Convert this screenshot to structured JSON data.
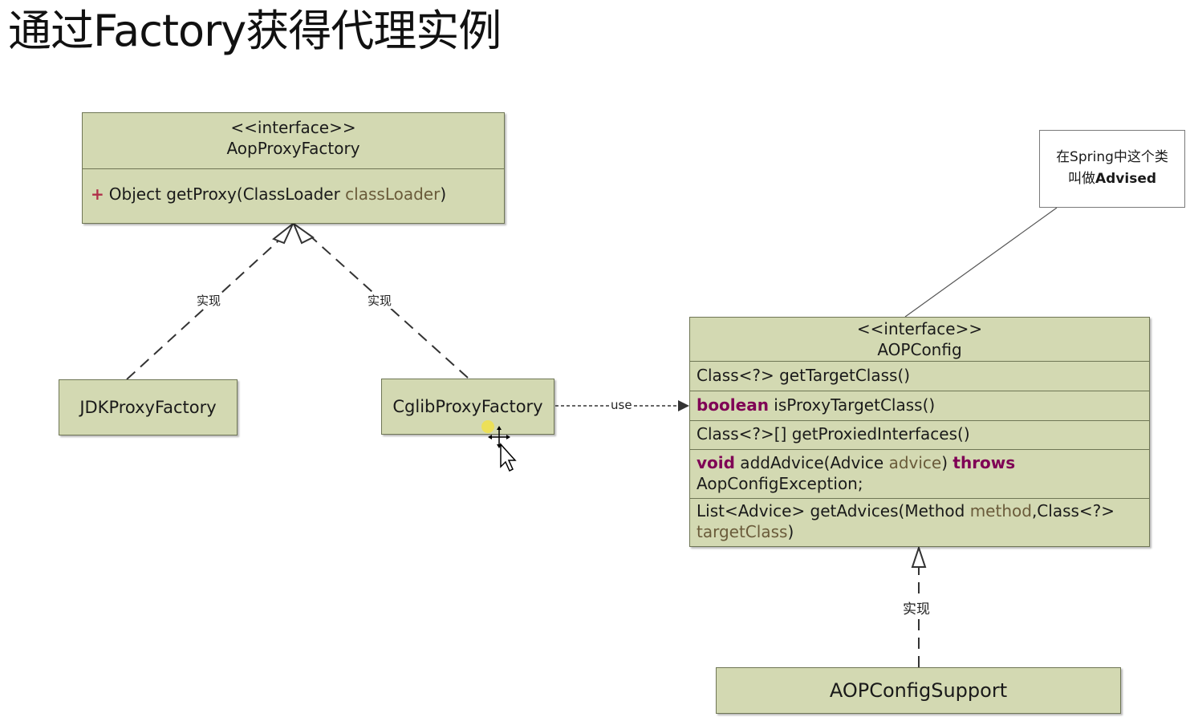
{
  "title": "通过Factory获得代理实例",
  "aop_proxy_factory": {
    "stereotype": "<<interface>>",
    "name": "AopProxyFactory",
    "method_visibility": "+",
    "method_prefix": "Object getProxy(ClassLoader ",
    "method_param": "classLoader",
    "method_suffix": ")"
  },
  "jdk_proxy_factory": {
    "name": "JDKProxyFactory"
  },
  "cglib_proxy_factory": {
    "name": "CglibProxyFactory"
  },
  "aop_config": {
    "stereotype": "<<interface>>",
    "name": "AOPConfig",
    "m1": "Class<?> getTargetClass()",
    "m2_kw": "boolean",
    "m2_rest": " isProxyTargetClass()",
    "m3": "Class<?>[] getProxiedInterfaces()",
    "m4_kw1": "void",
    "m4_mid": " addAdvice(Advice ",
    "m4_param": "advice",
    "m4_close": ") ",
    "m4_kw2": "throws",
    "m4_line2": "AopConfigException;",
    "m5_line1_a": "List<Advice> getAdvices(Method ",
    "m5_param1": "method",
    "m5_line1_b": ",Class<?>",
    "m5_param2": "targetClass",
    "m5_end": ")"
  },
  "aop_config_support": {
    "name": "AOPConfigSupport"
  },
  "note": {
    "line1": "在Spring中这个类",
    "line2_prefix": "叫做",
    "line2_bold": "Advised"
  },
  "edges": {
    "jdk_realize": "实现",
    "cglib_realize": "实现",
    "use": "use",
    "support_realize": "实现"
  },
  "colors": {
    "class_fill": "#d3d9b2",
    "class_border": "#6f7655",
    "keyword": "#7f0055",
    "param": "#6a5b3a"
  }
}
